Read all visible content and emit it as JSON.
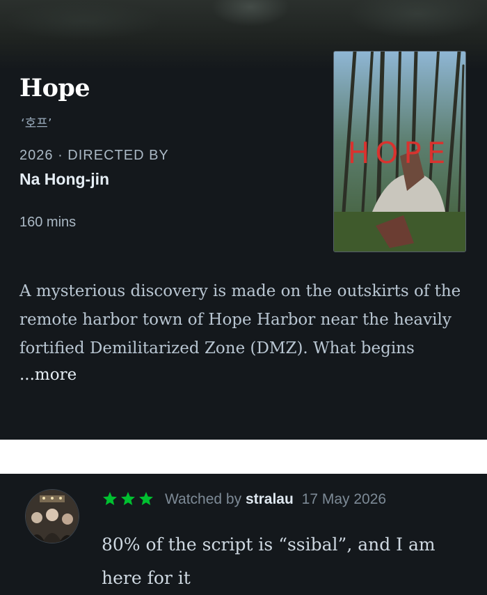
{
  "film": {
    "title": "Hope",
    "original_title": "‘호프’",
    "year": "2026",
    "directed_by_label": "· DIRECTED BY",
    "director": "Na Hong-jin",
    "runtime": "160 mins",
    "poster_title": "HOPE",
    "synopsis": "A mysterious discovery is made on the outskirts of the remote harbor town of Hope Harbor near the heavily fortified Demilitarized Zone (DMZ). What begins",
    "more_label": "...more"
  },
  "review": {
    "rating_stars": 3,
    "watched_prefix": "Watched by",
    "username": "stralau",
    "date": "17 May 2026",
    "text": "80% of the script is “ssibal”, and I am here for it"
  },
  "colors": {
    "background": "#14181c",
    "star_green": "#00c030",
    "poster_title_red": "#d8332f"
  }
}
